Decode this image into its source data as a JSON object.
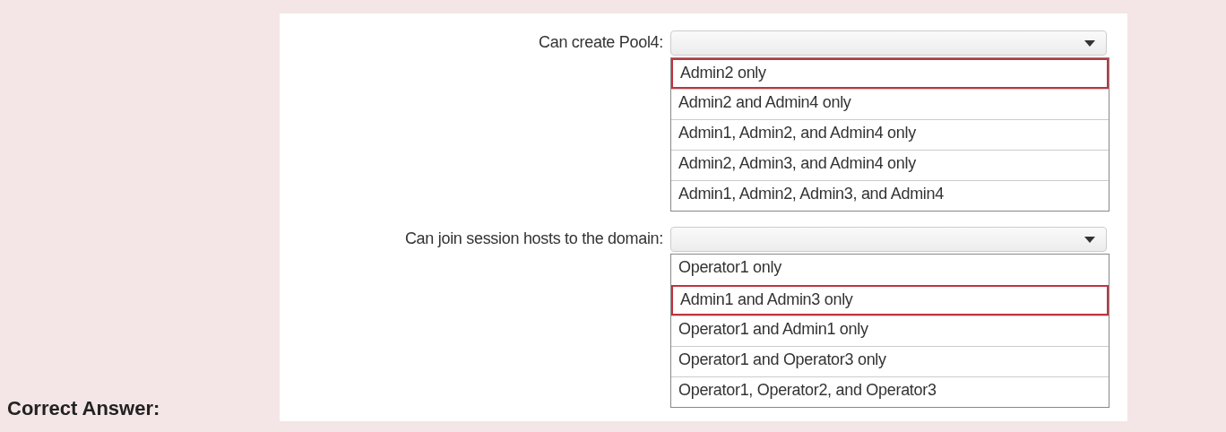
{
  "answer_label": "Correct Answer:",
  "questions": [
    {
      "label": "Can create Pool4:",
      "options": [
        {
          "text": "Admin2 only",
          "selected": true
        },
        {
          "text": "Admin2 and Admin4 only",
          "selected": false
        },
        {
          "text": "Admin1, Admin2, and Admin4 only",
          "selected": false
        },
        {
          "text": "Admin2, Admin3, and Admin4 only",
          "selected": false
        },
        {
          "text": "Admin1, Admin2, Admin3, and Admin4",
          "selected": false
        }
      ]
    },
    {
      "label": "Can join session hosts to the domain:",
      "options": [
        {
          "text": "Operator1 only",
          "selected": false
        },
        {
          "text": "Admin1 and Admin3 only",
          "selected": true
        },
        {
          "text": "Operator1 and Admin1 only",
          "selected": false
        },
        {
          "text": "Operator1 and Operator3 only",
          "selected": false
        },
        {
          "text": "Operator1, Operator2, and Operator3",
          "selected": false
        }
      ]
    }
  ]
}
